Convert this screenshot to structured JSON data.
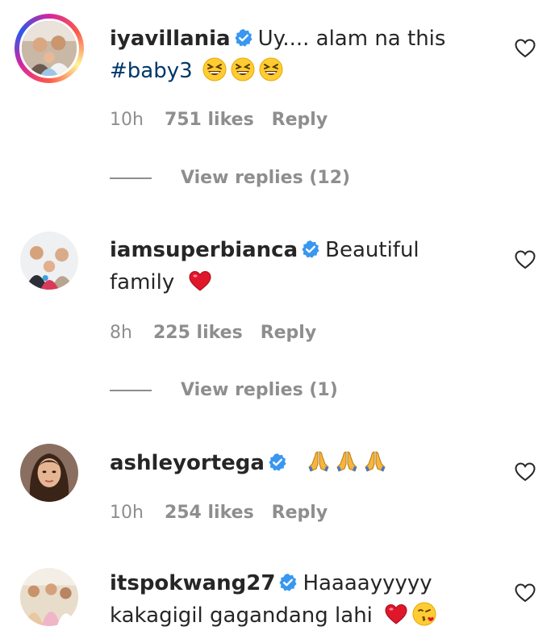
{
  "comments": [
    {
      "username": "iyavillania",
      "verified": true,
      "text": "Uy.... alam na this",
      "hashtag": "#baby3",
      "emojis": [
        "grinning-squinting-face",
        "grinning-squinting-face",
        "grinning-squinting-face"
      ],
      "time": "10h",
      "likes": "751 likes",
      "reply": "Reply",
      "view_replies": "View replies (12)"
    },
    {
      "username": "iamsuperbianca",
      "verified": true,
      "text_line1": "Beautiful",
      "text_line2": "family",
      "emojis": [
        "red-heart"
      ],
      "time": "8h",
      "likes": "225 likes",
      "reply": "Reply",
      "view_replies": "View replies (1)"
    },
    {
      "username": "ashleyortega",
      "verified": true,
      "emojis": [
        "folded-hands",
        "folded-hands",
        "folded-hands"
      ],
      "time": "10h",
      "likes": "254 likes",
      "reply": "Reply"
    },
    {
      "username": "itspokwang27",
      "verified": true,
      "text_line1": "Haaaayyyyy",
      "text_line2": "kakagigil gagandang lahi",
      "emojis": [
        "red-heart",
        "face-blowing-kiss"
      ]
    }
  ],
  "colors": {
    "text": "#262626",
    "muted": "#8e8e8e",
    "verified": "#3897f0",
    "hashtag": "#00376b"
  }
}
